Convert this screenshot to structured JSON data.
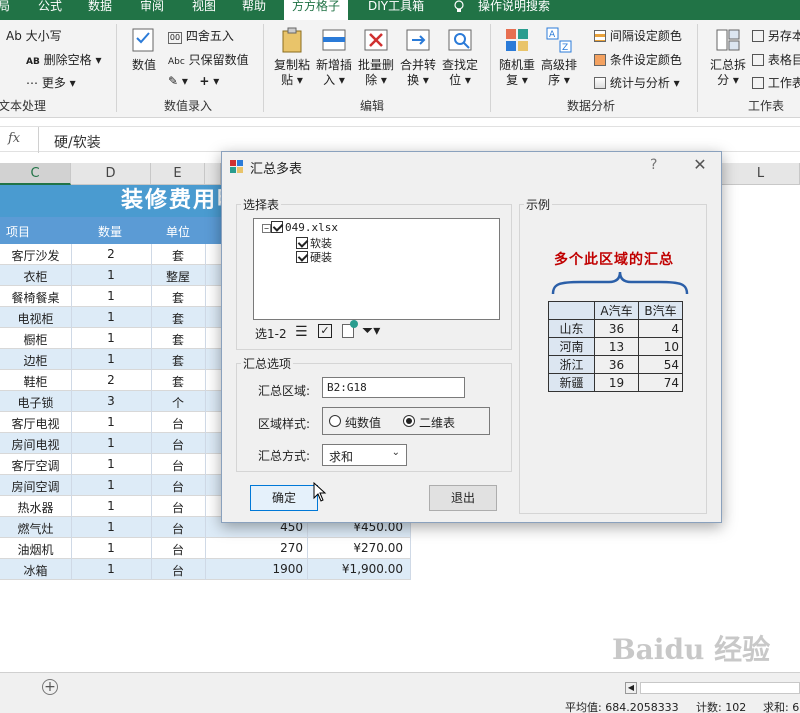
{
  "ribbon_tabs": [
    "局",
    "公式",
    "数据",
    "审阅",
    "视图",
    "帮助",
    "方方格子",
    "DIY工具箱",
    "操作说明搜索"
  ],
  "active_tab": "方方格子",
  "ribbon": {
    "text_group": {
      "case_btn": "Ab 大小写",
      "del_space_btn": "删除空格",
      "more_btn": "更多",
      "label": "文本处理"
    },
    "numeric_group": {
      "value_btn": "数值",
      "round_btn": "四舍五入",
      "keep_value_btn": "只保留数值",
      "label": "数值录入"
    },
    "edit_group": {
      "copy_paste": "复制粘贴",
      "new_insert": "新增插入",
      "batch_delete": "批量删除",
      "merge_convert": "合并转换",
      "find_locate": "查找定位",
      "label": "编辑"
    },
    "analysis_group": {
      "random_repeat": "随机重复",
      "advanced_sort": "高级排序",
      "interval_color": "间隔设定颜色",
      "cond_color": "条件设定颜色",
      "stats_analysis": "统计与分析",
      "label": "数据分析"
    },
    "sheet_group": {
      "summary_split": "汇总拆分",
      "save_as": "另存本",
      "table_dir": "表格目",
      "worksheet": "工作表",
      "label": "工作表"
    }
  },
  "formula_bar": {
    "fx": "fx",
    "value": "硬/软装"
  },
  "columns": [
    "C",
    "D",
    "E",
    "L"
  ],
  "sheet": {
    "title": "装修费用明细表",
    "headers": [
      "项目",
      "数量",
      "单位"
    ],
    "rows": [
      {
        "item": "客厅沙发",
        "qty": "2",
        "unit": "套",
        "price": "",
        "total": ""
      },
      {
        "item": "衣柜",
        "qty": "1",
        "unit": "整屋",
        "price": "",
        "total": ""
      },
      {
        "item": "餐椅餐桌",
        "qty": "1",
        "unit": "套",
        "price": "",
        "total": ""
      },
      {
        "item": "电视柜",
        "qty": "1",
        "unit": "套",
        "price": "",
        "total": ""
      },
      {
        "item": "橱柜",
        "qty": "1",
        "unit": "套",
        "price": "",
        "total": ""
      },
      {
        "item": "边柜",
        "qty": "1",
        "unit": "套",
        "price": "",
        "total": ""
      },
      {
        "item": "鞋柜",
        "qty": "2",
        "unit": "套",
        "price": "",
        "total": ""
      },
      {
        "item": "电子锁",
        "qty": "3",
        "unit": "个",
        "price": "",
        "total": ""
      },
      {
        "item": "客厅电视",
        "qty": "1",
        "unit": "台",
        "price": "",
        "total": ""
      },
      {
        "item": "房间电视",
        "qty": "1",
        "unit": "台",
        "price": "",
        "total": ""
      },
      {
        "item": "客厅空调",
        "qty": "1",
        "unit": "台",
        "price": "",
        "total": ""
      },
      {
        "item": "房间空调",
        "qty": "1",
        "unit": "台",
        "price": "",
        "total": ""
      },
      {
        "item": "热水器",
        "qty": "1",
        "unit": "台",
        "price": "",
        "total": ""
      },
      {
        "item": "燃气灶",
        "qty": "1",
        "unit": "台",
        "price": "450",
        "total": "¥450.00"
      },
      {
        "item": "油烟机",
        "qty": "1",
        "unit": "台",
        "price": "270",
        "total": "¥270.00"
      },
      {
        "item": "冰箱",
        "qty": "1",
        "unit": "台",
        "price": "1900",
        "total": "¥1,900.00"
      }
    ]
  },
  "dialog": {
    "title": "汇总多表",
    "help": "?",
    "close": "✕",
    "select_table_legend": "选择表",
    "tree": {
      "root": "049.xlsx",
      "children": [
        "软装",
        "硬装"
      ]
    },
    "selection_info": "选1-2",
    "options_legend": "汇总选项",
    "range_label": "汇总区域:",
    "range_value": "B2:G18",
    "style_label": "区域样式:",
    "style_options": [
      "纯数值",
      "二维表"
    ],
    "style_selected": "二维表",
    "method_label": "汇总方式:",
    "method_value": "求和",
    "ok_btn": "确定",
    "exit_btn": "退出",
    "example_legend": "示例",
    "example_caption": "多个此区域的汇总",
    "example_table": {
      "headers": [
        "",
        "A汽车",
        "B汽车"
      ],
      "rows": [
        [
          "山东",
          "36",
          "4"
        ],
        [
          "河南",
          "13",
          "10"
        ],
        [
          "浙江",
          "36",
          "54"
        ],
        [
          "新疆",
          "19",
          "74"
        ]
      ]
    }
  },
  "status": {
    "avg": "平均值: 684.2058333",
    "count": "计数: 102",
    "sum": "求和: 6"
  },
  "watermark": "Baidu 经验"
}
